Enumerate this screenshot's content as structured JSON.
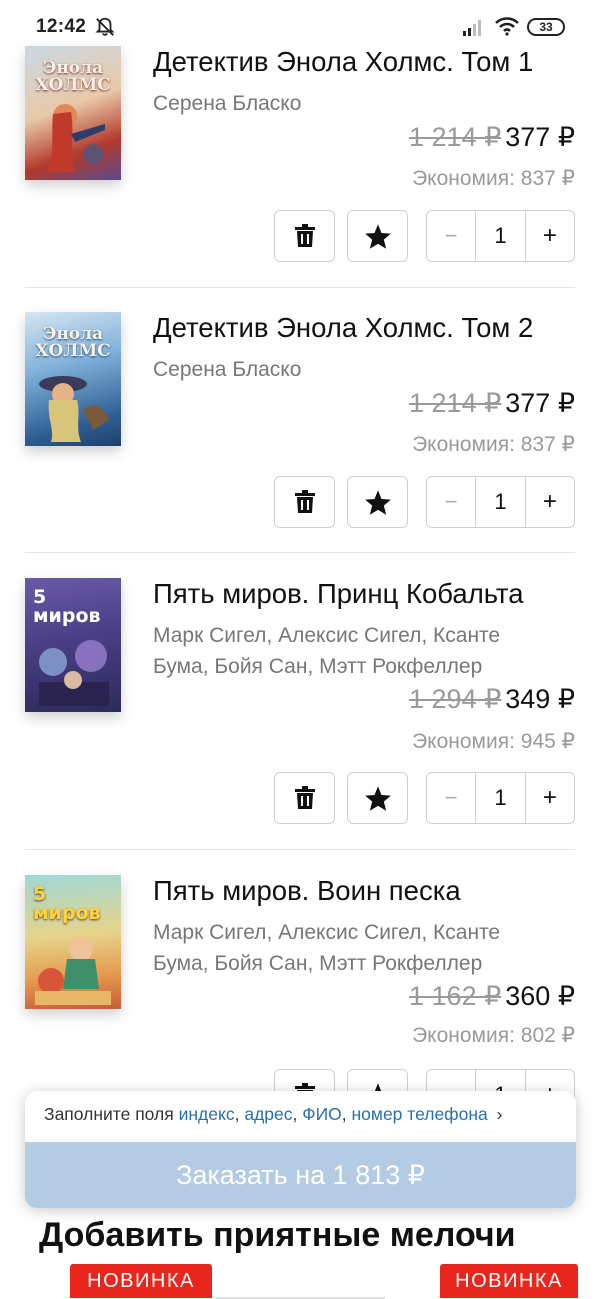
{
  "status_bar": {
    "time": "12:42",
    "battery": "33"
  },
  "currency": "₽",
  "items": [
    {
      "title": "Детектив Энола Холмс. Том 1",
      "cover_text": "Энола ХОЛМС",
      "authors_line1": "Серена Бласко",
      "authors_line2": "",
      "old_price": "1 214 ₽",
      "new_price": "377 ₽",
      "savings": "Экономия: 837 ₽",
      "quantity": "1",
      "minus": "−",
      "plus": "+"
    },
    {
      "title": "Детектив Энола Холмс. Том 2",
      "cover_text": "Энола ХОЛМС",
      "authors_line1": "Серена Бласко",
      "authors_line2": "",
      "old_price": "1 214 ₽",
      "new_price": "377 ₽",
      "savings": "Экономия: 837 ₽",
      "quantity": "1",
      "minus": "−",
      "plus": "+"
    },
    {
      "title": "Пять миров. Принц Кобальта",
      "cover_text": "5 миров",
      "authors_line1": "Марк Сигел, Алексис Сигел, Ксанте",
      "authors_line2": "Бума, Бойя Сан, Мэтт Рокфеллер",
      "old_price": "1 294 ₽",
      "new_price": "349 ₽",
      "savings": "Экономия: 945 ₽",
      "quantity": "1",
      "minus": "−",
      "plus": "+"
    },
    {
      "title": "Пять миров. Воин песка",
      "cover_text": "5 миров",
      "authors_line1": "Марк Сигел, Алексис Сигел, Ксанте",
      "authors_line2": "Бума, Бойя Сан, Мэтт Рокфеллер",
      "old_price": "1 162 ₽",
      "new_price": "360 ₽",
      "savings": "Экономия: 802 ₽",
      "quantity": "1",
      "minus": "−",
      "plus": "+"
    }
  ],
  "order": {
    "hint_prefix": "Заполните поля",
    "field_index": "индекс",
    "field_address": "адрес",
    "field_name": "ФИО",
    "field_phone": "номер телефона",
    "comma": ",",
    "chevron": "›",
    "button_label": "Заказать на 1 813 ₽"
  },
  "section_title": "Добавить приятные мелочи",
  "badges": [
    "НОВИНКА",
    "НОВИНКА"
  ],
  "colors": {
    "link": "#2a6fb0",
    "order_button": "#b4cbe4",
    "badge": "#e8261c"
  },
  "icons": {
    "delete": "trash-icon",
    "favorite": "star-icon",
    "dnd": "bell-off-icon",
    "signal": "signal-icon",
    "wifi": "wifi-icon"
  }
}
